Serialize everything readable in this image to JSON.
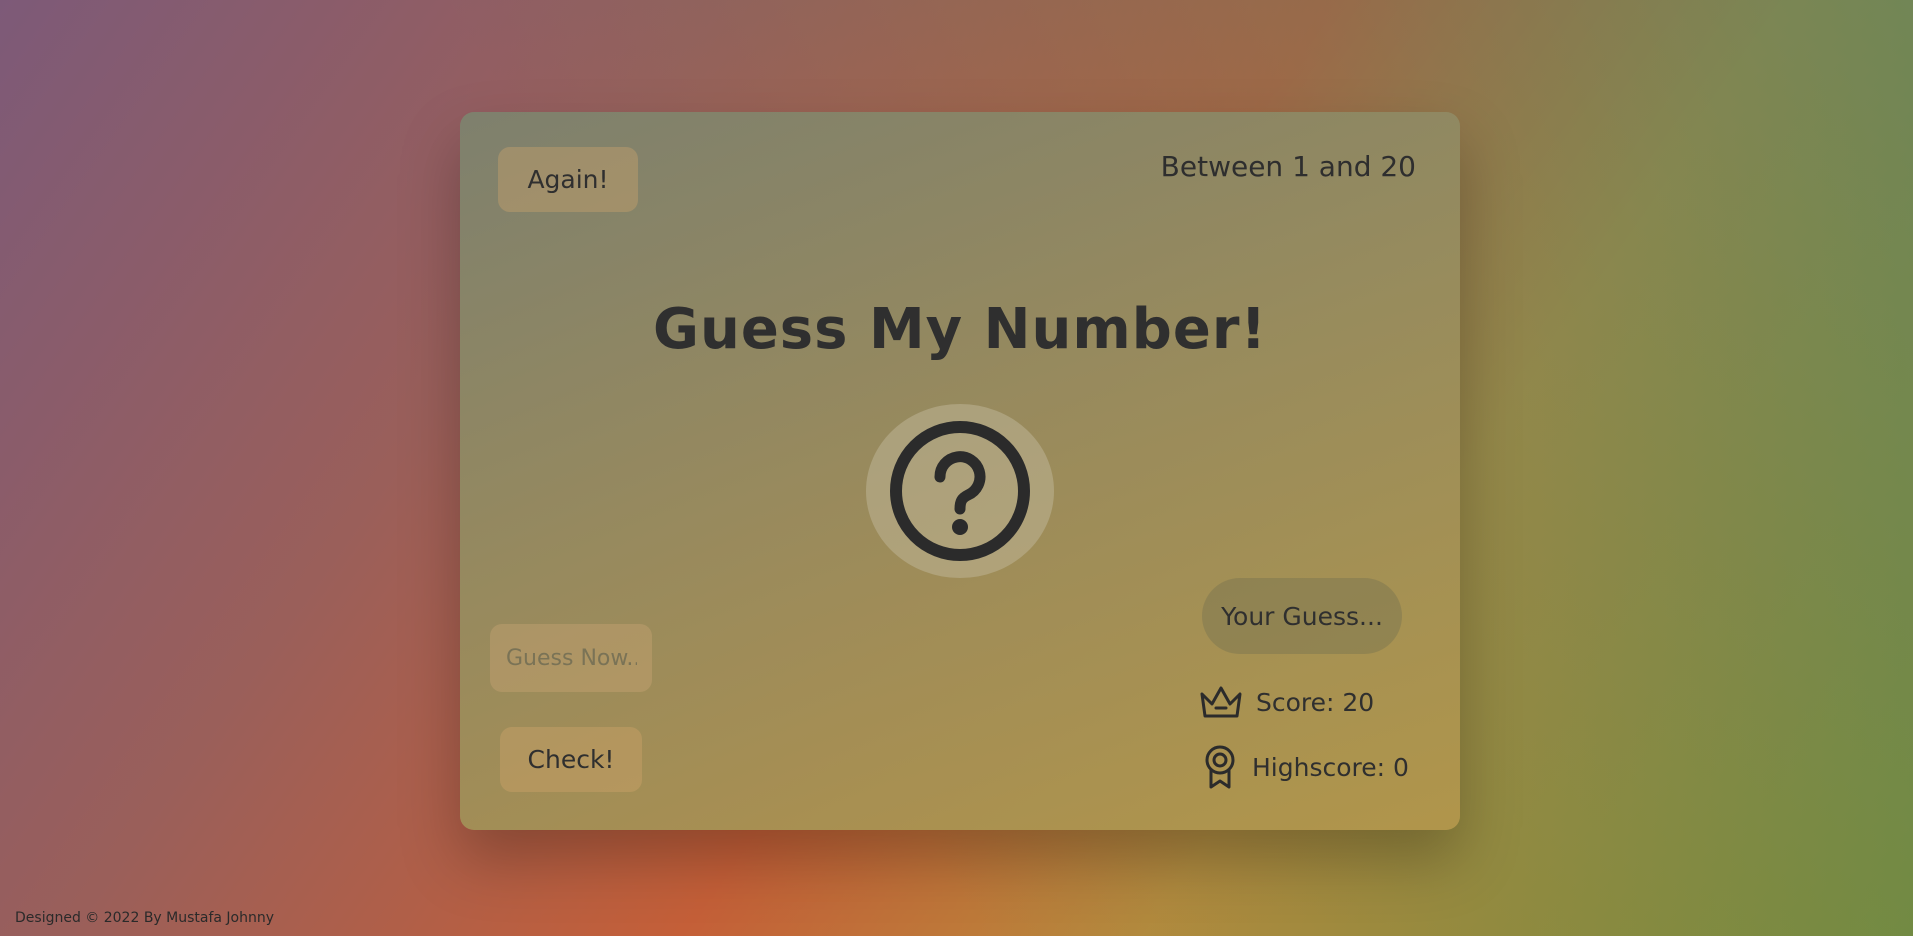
{
  "header": {
    "again_label": "Again!",
    "range_text": "Between 1 and 20"
  },
  "main": {
    "title": "Guess My Number!",
    "secret_icon": "question-circle-icon",
    "input_placeholder": "Guess Now..",
    "check_label": "Check!",
    "message": "Your Guess...",
    "score_text": "Score: 20",
    "highscore_text": "Highscore: 0",
    "score_icon": "crown-icon",
    "highscore_icon": "award-icon"
  },
  "footer": {
    "credit": "Designed © 2022 By Mustafa Johnny"
  }
}
